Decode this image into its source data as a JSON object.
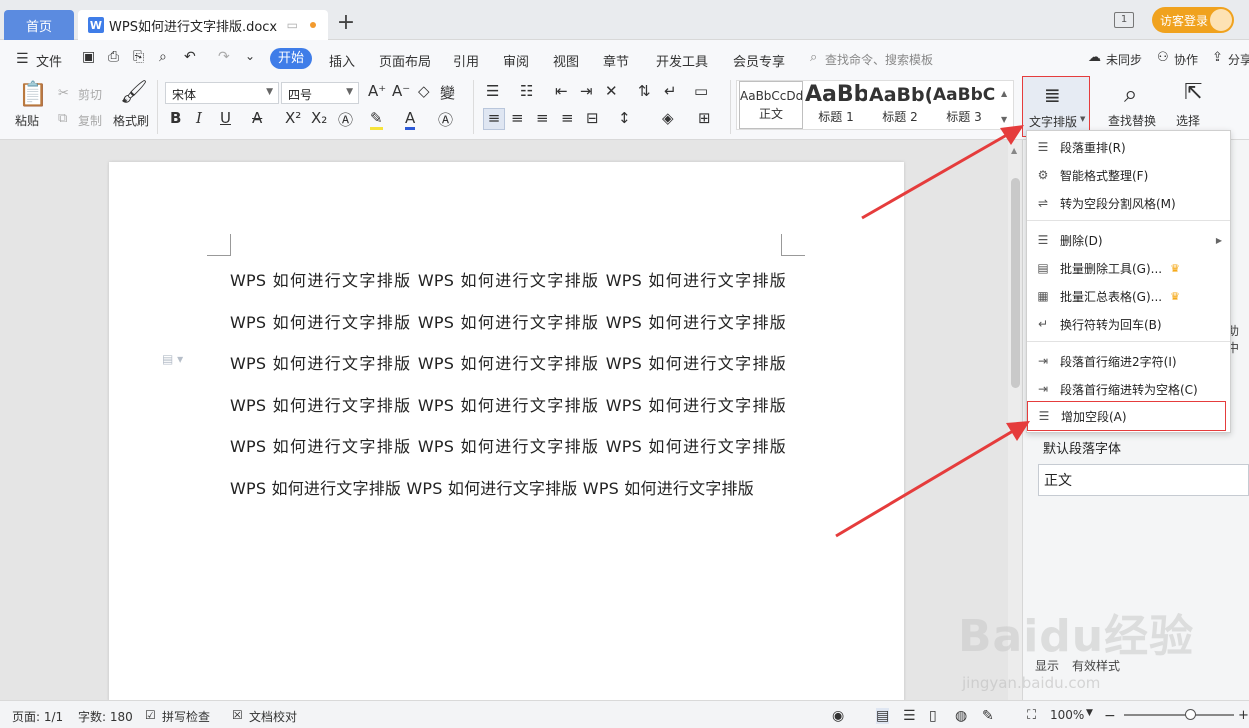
{
  "titlebar": {
    "home_tab": "首页",
    "doc_tab": "WPS如何进行文字排版.docx",
    "add_tab": "+",
    "visitor_login": "访客登录",
    "page_indicator": "1"
  },
  "menubar": {
    "file": "文件",
    "items": [
      "开始",
      "插入",
      "页面布局",
      "引用",
      "审阅",
      "视图",
      "章节",
      "开发工具",
      "会员专享"
    ],
    "search_placeholder": "查找命令、搜索模板",
    "sync": "未同步",
    "collab": "协作",
    "share": "分享"
  },
  "ribbon": {
    "paste": "粘贴",
    "cut": "剪切",
    "copy": "复制",
    "format_painter": "格式刷",
    "font_name": "宋体",
    "font_size": "四号",
    "styles": [
      {
        "preview": "AaBbCcDd",
        "label": "正文"
      },
      {
        "preview": "AaBb",
        "label": "标题 1"
      },
      {
        "preview": "AaBb(",
        "label": "标题 2"
      },
      {
        "preview": "AaBbC",
        "label": "标题 3"
      }
    ],
    "text_layout": "文字排版",
    "find_replace": "查找替换",
    "select": "选择"
  },
  "document": {
    "body": "WPS 如何进行文字排版 WPS 如何进行文字排版 WPS 如何进行文字排版 WPS 如何进行文字排版 WPS 如何进行文字排版 WPS 如何进行文字排版 WPS 如何进行文字排版 WPS 如何进行文字排版 WPS 如何进行文字排版 WPS 如何进行文字排版 WPS 如何进行文字排版 WPS 如何进行文字排版 WPS 如何进行文字排版 WPS 如何进行文字排版 WPS 如何进行文字排版 WPS 如何进行文字排版 WPS 如何进行文字排版 WPS 如何进行文字排版"
  },
  "dropdown": {
    "items": [
      {
        "label": "段落重排(R)",
        "icon": "paragraph-rearrange-icon"
      },
      {
        "label": "智能格式整理(F)",
        "icon": "smart-format-icon"
      },
      {
        "label": "转为空段分割风格(M)",
        "icon": "blank-split-icon"
      },
      {
        "label": "删除(D)",
        "icon": "delete-lines-icon"
      },
      {
        "label": "批量删除工具(G)...",
        "icon": "batch-delete-icon"
      },
      {
        "label": "批量汇总表格(G)...",
        "icon": "batch-table-icon"
      },
      {
        "label": "换行符转为回车(B)",
        "icon": "linebreak-icon"
      },
      {
        "label": "段落首行缩进2字符(I)",
        "icon": "indent-icon"
      },
      {
        "label": "段落首行缩进转为空格(C)",
        "icon": "indent-space-icon"
      },
      {
        "label": "增加空段(A)",
        "icon": "add-blank-paragraph-icon"
      }
    ]
  },
  "right_pane": {
    "default_font": "默认段落字体",
    "body_style": "正文",
    "display": "显示",
    "valid_styles": "有效样式",
    "help": "助中"
  },
  "statusbar": {
    "page": "页面: 1/1",
    "word_count": "字数: 180",
    "spell_check": "拼写检查",
    "doc_proof": "文档校对",
    "zoom": "100%",
    "zoom_fraction": 0.6
  },
  "watermark": {
    "brand": "Baidu经验",
    "url": "jingyan.baidu.com"
  },
  "colors": {
    "accent": "#3f7de8",
    "annotation": "#e53c3c",
    "visitor": "#f0a21e"
  }
}
